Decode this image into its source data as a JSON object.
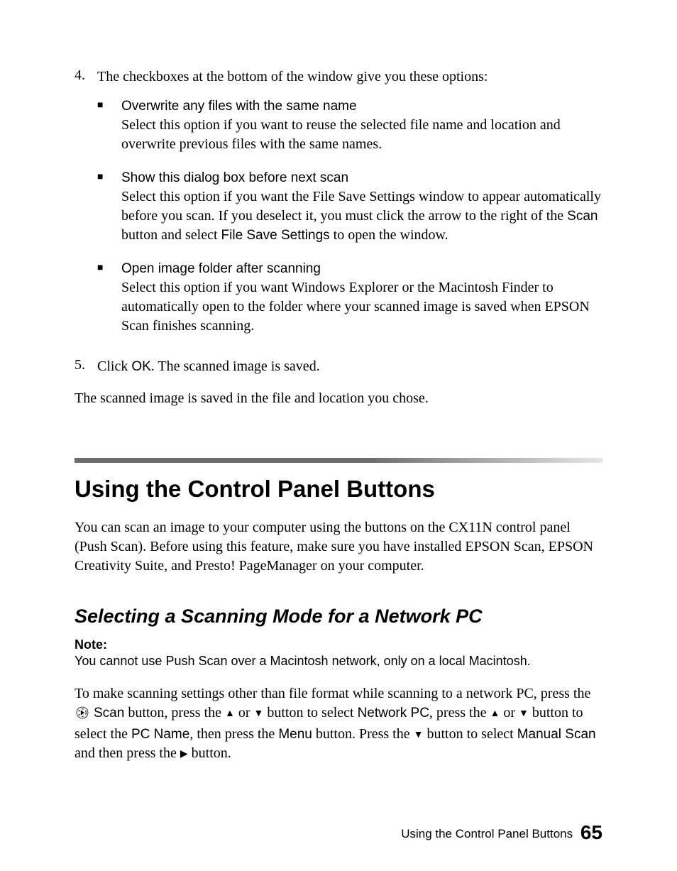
{
  "step4": {
    "num": "4.",
    "intro": "The checkboxes at the bottom of the window give you these options:",
    "items": [
      {
        "title": "Overwrite any files with the same name",
        "desc": "Select this option if you want to reuse the selected file name and location and overwrite previous files with the same names."
      },
      {
        "title": "Show this dialog box before next scan",
        "desc_pre": "Select this option if you want the File Save Settings window to appear automatically before you scan. If you deselect it, you must click the arrow to the right of the ",
        "scan": "Scan",
        "desc_mid": " button and select ",
        "fss": "File Save Settings",
        "desc_post": " to open the window."
      },
      {
        "title": "Open image folder after scanning",
        "desc": "Select this option if you want Windows Explorer or the Macintosh Finder to automatically open to the folder where your scanned image is saved when EPSON Scan finishes scanning."
      }
    ]
  },
  "step5": {
    "num": "5.",
    "pre": "Click ",
    "ok": "OK",
    "post": ". The scanned image is saved."
  },
  "closing": "The scanned image is saved in the file and location you chose.",
  "section_title": "Using the Control Panel Buttons",
  "section_intro": "You can scan an image to your computer using the buttons on the CX11N control panel (Push Scan). Before using this feature, make sure you have installed EPSON Scan, EPSON Creativity Suite, and Presto! PageManager on your computer.",
  "sub_title": "Selecting a Scanning Mode for a Network PC",
  "note_label": "Note:",
  "note_body": "You cannot use Push Scan over a Macintosh network, only on a local Macintosh.",
  "net": {
    "a": "To make scanning settings other than file format while scanning to a network PC, press the ",
    "scan": "Scan",
    "b": " button, press the ",
    "c": " or ",
    "d": " button to select ",
    "netpc": "Network PC",
    "e": ", press the ",
    "f": " or ",
    "g": " button to select the ",
    "pcname": "PC Name",
    "h": ", then press the ",
    "menu": "Menu",
    "i": " button. Press the ",
    "j": " button to select ",
    "manual": "Manual Scan",
    "k": " and then press the ",
    "l": " button."
  },
  "glyphs": {
    "square": "■",
    "up": "▲",
    "down": "▼",
    "right": "▶"
  },
  "footer": {
    "text": "Using the Control Panel Buttons",
    "page": "65"
  }
}
